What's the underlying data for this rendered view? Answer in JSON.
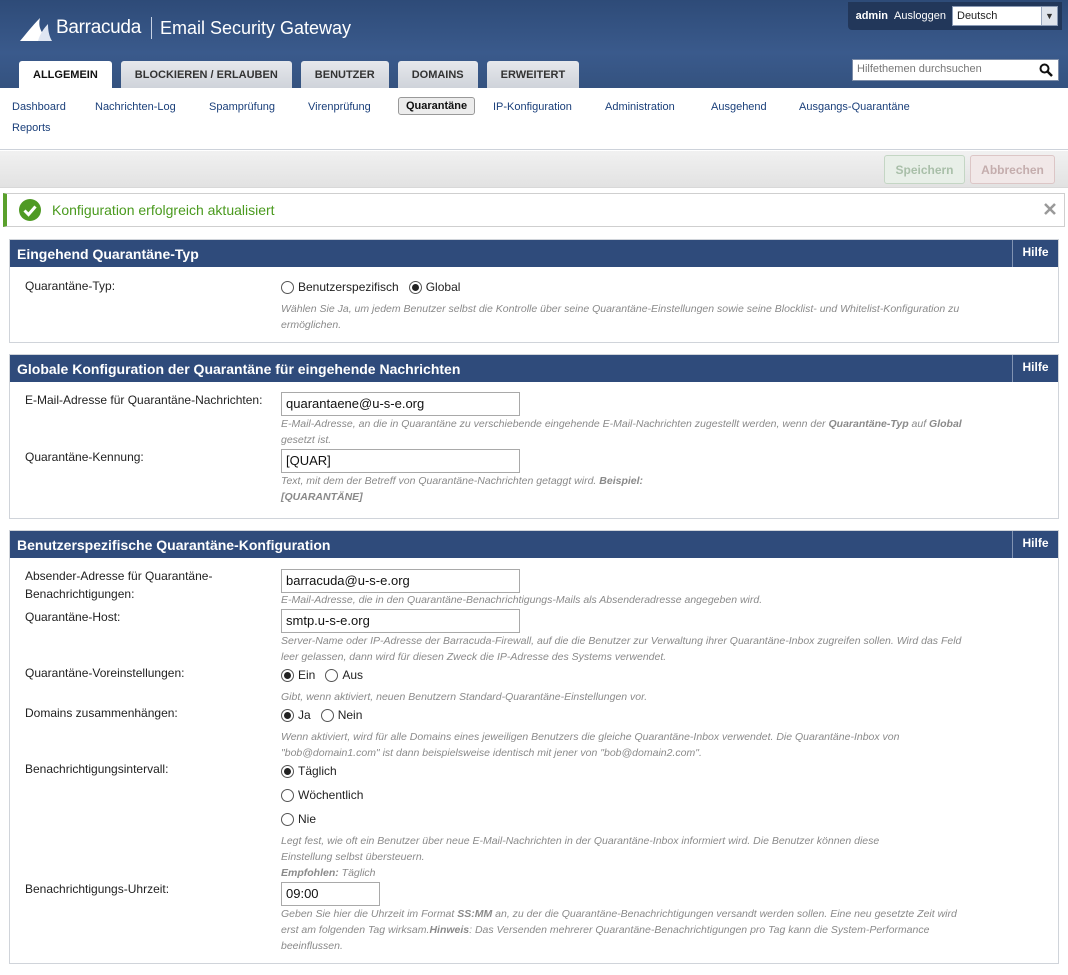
{
  "app": {
    "brand": "Barracuda",
    "product": "Email Security Gateway",
    "user": "admin",
    "logout": "Ausloggen",
    "language": "Deutsch",
    "help_search_placeholder": "Hilfethemen durchsuchen"
  },
  "tabs": [
    "ALLGEMEIN",
    "BLOCKIEREN / ERLAUBEN",
    "BENUTZER",
    "DOMAINS",
    "ERWEITERT"
  ],
  "subnav": [
    "Dashboard",
    "Nachrichten-Log",
    "Spamprüfung",
    "Virenprüfung",
    "Quarantäne",
    "IP-Konfiguration",
    "Administration",
    "Ausgehend",
    "Ausgangs-Quarantäne",
    "Reports"
  ],
  "actions": {
    "save": "Speichern",
    "cancel": "Abbrechen"
  },
  "notice": "Konfiguration erfolgreich aktualisiert",
  "hilfe": "Hilfe",
  "section1": {
    "title": "Eingehend Quarantäne-Typ",
    "type_label": "Quarantäne-Typ:",
    "opt_user": "Benutzerspezifisch",
    "opt_global": "Global",
    "help": "Wählen Sie Ja, um jedem Benutzer selbst die Kontrolle über seine Quarantäne-Einstellungen sowie seine Blocklist- und Whitelist-Konfiguration zu ermöglichen."
  },
  "section2": {
    "title": "Globale Konfiguration der Quarantäne für eingehende Nachrichten",
    "email_label": "E-Mail-Adresse für Quarantäne-Nachrichten:",
    "email_value": "quarantaene@u-s-e.org",
    "email_help_1": "E-Mail-Adresse, an die in Quarantäne zu verschiebende eingehende E-Mail-Nachrichten zugestellt werden, wenn der ",
    "email_help_b1": "Quarantäne-Typ",
    "email_help_2": " auf ",
    "email_help_b2": "Global",
    "email_help_3": " gesetzt ist.",
    "tag_label": "Quarantäne-Kennung:",
    "tag_value": "[QUAR]",
    "tag_help_1": "Text, mit dem der Betreff von Quarantäne-Nachrichten getaggt wird. ",
    "tag_help_b": "Beispiel: [QUARANTÄNE]"
  },
  "section3": {
    "title": "Benutzerspezifische Quarantäne-Konfiguration",
    "sender_label": "Absender-Adresse für Quarantäne-Benachrichtigungen:",
    "sender_value": "barracuda@u-s-e.org",
    "sender_help": "E-Mail-Adresse, die in den Quarantäne-Benachrichtigungs-Mails als Absenderadresse angegeben wird.",
    "host_label": "Quarantäne-Host:",
    "host_value": "smtp.u-s-e.org",
    "host_help": "Server-Name oder IP-Adresse der Barracuda-Firewall, auf die die Benutzer zur Verwaltung ihrer Quarantäne-Inbox zugreifen sollen. Wird das Feld leer gelassen, dann wird für diesen Zweck die IP-Adresse des Systems verwendet.",
    "defaults_label": "Quarantäne-Voreinstellungen:",
    "opt_on": "Ein",
    "opt_off": "Aus",
    "defaults_help": "Gibt, wenn aktiviert, neuen Benutzern Standard-Quarantäne-Einstellungen vor.",
    "domains_label": "Domains zusammenhängen:",
    "opt_yes": "Ja",
    "opt_no": "Nein",
    "domains_help": "Wenn aktiviert, wird für alle Domains eines jeweiligen Benutzers die gleiche Quarantäne-Inbox verwendet. Die Quarantäne-Inbox von \"bob@domain1.com\" ist dann beispielsweise identisch mit jener von \"bob@domain2.com\".",
    "interval_label": "Benachrichtigungsintervall:",
    "opt_daily": "Täglich",
    "opt_weekly": "Wöchentlich",
    "opt_never": "Nie",
    "interval_help": "Legt fest, wie oft ein Benutzer über neue E-Mail-Nachrichten in der Quarantäne-Inbox informiert wird. Die Benutzer können diese Einstellung selbst übersteuern.",
    "interval_rec_b": "Empfohlen:",
    "interval_rec": " Täglich",
    "time_label": "Benachrichtigungs-Uhrzeit:",
    "time_value": "09:00",
    "time_help_1": "Geben Sie hier die Uhrzeit im Format ",
    "time_help_b1": "SS:MM",
    "time_help_2": " an, zu der die Quarantäne-Benachrichtigungen versandt werden sollen. Eine neu gesetzte Zeit wird erst am folgenden Tag wirksam.",
    "time_help_b2": "Hinweis",
    "time_help_3": ": Das Versenden mehrerer Quarantäne-Benachrichtigungen pro Tag kann die System-Performance beeinflussen."
  }
}
